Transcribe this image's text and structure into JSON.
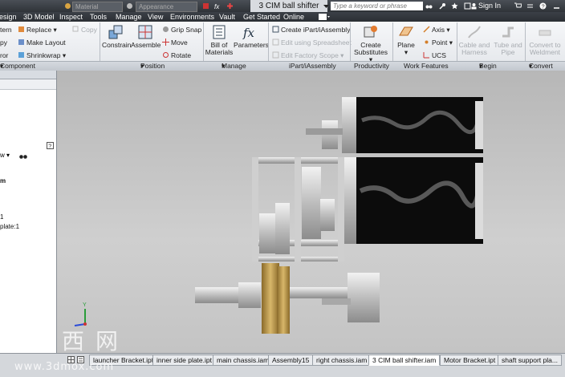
{
  "titlebar": {
    "material_placeholder": "Material",
    "appearance_placeholder": "Appearance",
    "document_title": "3 CIM ball shifter",
    "search_placeholder": "Type a keyword or phrase",
    "sign_in": "Sign In"
  },
  "menu": [
    "esign",
    "3D Model",
    "Inspect",
    "Tools",
    "Manage",
    "View",
    "Environments",
    "Vault",
    "Get Started",
    "Online"
  ],
  "ribbon": {
    "component": {
      "items": [
        "tern",
        "py",
        "ror"
      ],
      "replace": "Replace",
      "make_layout": "Make Layout",
      "shrinkwrap": "Shrinkwrap",
      "copy": "Copy"
    },
    "position": {
      "constrain": "Constrain",
      "assemble": "Assemble",
      "grip_snap": "Grip Snap",
      "move": "Move",
      "rotate": "Rotate"
    },
    "manage": {
      "bill_of_materials": [
        "Bill of",
        "Materials"
      ],
      "parameters": "Parameters"
    },
    "ipart": {
      "create": "Create iPart/iAssembly",
      "edit_spreadsheet": "Edit using Spreadsheet",
      "edit_factory": "Edit Factory Scope"
    },
    "productivity": {
      "create_substitutes": [
        "Create",
        "Substitutes"
      ]
    },
    "work_features": {
      "plane": "Plane",
      "axis": "Axis",
      "point": "Point",
      "ucs": "UCS"
    },
    "begin": {
      "cable": [
        "Cable and",
        "Harness"
      ],
      "tube": [
        "Tube and",
        "Pipe"
      ]
    },
    "convert": {
      "weldment": [
        "Convert to",
        "Weldment"
      ]
    }
  },
  "panel_labels": [
    "Component",
    "Position",
    "Manage",
    "iPart/iAssembly",
    "Productivity",
    "Work Features",
    "Begin",
    "Convert"
  ],
  "browser": {
    "view_label": "w",
    "tree": [
      "m",
      "",
      "",
      "1",
      "plate:1"
    ]
  },
  "document_tabs": [
    "launcher Bracket.ipt",
    "inner side plate.ipt",
    "main chassis.iam",
    "Assembly15",
    "right chassis.iam",
    "3 CIM ball shifter.iam",
    "Motor Bracket.ipt",
    "shaft support pla..."
  ],
  "active_tab": "3 CIM ball shifter.iam",
  "watermark": {
    "chars": "莫西网",
    "url": "www.3dmox.com"
  },
  "colors": {
    "ribbon_bg": "#e9ecef",
    "titlebar": "#33373c",
    "gear_brass": "#b9964a",
    "motor_black": "#111111"
  }
}
